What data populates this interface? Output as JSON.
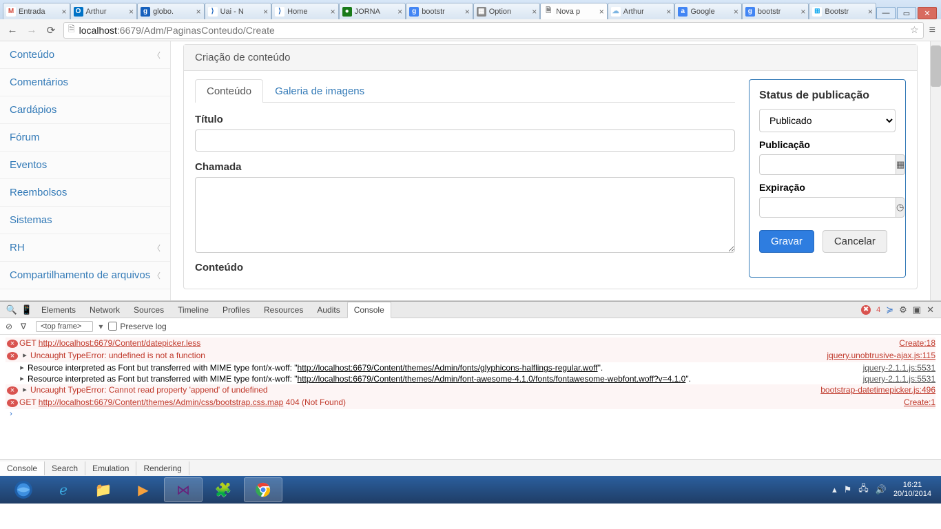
{
  "browser": {
    "tabs": [
      {
        "label": "Entrada",
        "favicon_bg": "#fff",
        "favicon_fg": "#d54b3d",
        "favicon_text": "M"
      },
      {
        "label": "Arthur",
        "favicon_bg": "#0072c6",
        "favicon_fg": "#fff",
        "favicon_text": "O"
      },
      {
        "label": "globo.",
        "favicon_bg": "#1560bd",
        "favicon_fg": "#fff",
        "favicon_text": "g"
      },
      {
        "label": "Uai - N",
        "favicon_bg": "#fff",
        "favicon_fg": "#1560bd",
        "favicon_text": "⟩"
      },
      {
        "label": "Home",
        "favicon_bg": "#fff",
        "favicon_fg": "#1560bd",
        "favicon_text": "⟩"
      },
      {
        "label": "JORNA",
        "favicon_bg": "#1a7a1a",
        "favicon_fg": "#fff",
        "favicon_text": "●"
      },
      {
        "label": "bootstr",
        "favicon_bg": "#4285f4",
        "favicon_fg": "#fff",
        "favicon_text": "g"
      },
      {
        "label": "Option",
        "favicon_bg": "#888",
        "favicon_fg": "#fff",
        "favicon_text": "▦"
      },
      {
        "label": "Nova p",
        "favicon_bg": "#fff",
        "favicon_fg": "#888",
        "favicon_text": "🗎",
        "active": true
      },
      {
        "label": "Arthur",
        "favicon_bg": "#fff",
        "favicon_fg": "#7cb5e2",
        "favicon_text": "☁"
      },
      {
        "label": "Google",
        "favicon_bg": "#4285f4",
        "favicon_fg": "#fff",
        "favicon_text": "a"
      },
      {
        "label": "bootstr",
        "favicon_bg": "#4285f4",
        "favicon_fg": "#fff",
        "favicon_text": "g"
      },
      {
        "label": "Bootstr",
        "favicon_bg": "#fff",
        "favicon_fg": "#00a4ef",
        "favicon_text": "⊞"
      }
    ],
    "url_host": "localhost",
    "url_port": ":6679",
    "url_path": "/Adm/PaginasConteudo/Create"
  },
  "sidebar": {
    "items": [
      {
        "label": "Conteúdo",
        "chevron": true
      },
      {
        "label": "Comentários"
      },
      {
        "label": "Cardápios"
      },
      {
        "label": "Fórum"
      },
      {
        "label": "Eventos"
      },
      {
        "label": "Reembolsos"
      },
      {
        "label": "Sistemas"
      },
      {
        "label": "RH",
        "chevron": true
      },
      {
        "label": "Compartilhamento de arquivos",
        "chevron": true
      }
    ]
  },
  "page": {
    "panel_title": "Criação de conteúdo",
    "tabs": {
      "content": "Conteúdo",
      "gallery": "Galeria de imagens"
    },
    "fields": {
      "title_label": "Título",
      "call_label": "Chamada",
      "content_label": "Conteúdo"
    },
    "publish": {
      "heading": "Status de publicação",
      "selected": "Publicado",
      "pub_label": "Publicação",
      "exp_label": "Expiração",
      "save": "Gravar",
      "cancel": "Cancelar"
    }
  },
  "devtools": {
    "tabs": {
      "elements": "Elements",
      "network": "Network",
      "sources": "Sources",
      "timeline": "Timeline",
      "profiles": "Profiles",
      "resources": "Resources",
      "audits": "Audits",
      "console": "Console"
    },
    "error_count": "4",
    "filter": {
      "frame": "<top frame>",
      "preserve": "Preserve log"
    },
    "logs": [
      {
        "type": "error",
        "method": "GET",
        "text_u": "http://localhost:6679/Content/datepicker.less",
        "src": "Create:18"
      },
      {
        "type": "uncaught",
        "text": "Uncaught TypeError: undefined is not a function",
        "src": "jquery.unobtrusive-ajax.js:115"
      },
      {
        "type": "info",
        "text_a": "Resource interpreted as Font but transferred with MIME type font/x-woff: \"",
        "text_u": "http://localhost:6679/Content/themes/Admin/fonts/glyphicons-halflings-regular.woff",
        "text_b": "\".",
        "src": "jquery-2.1.1.js:5531"
      },
      {
        "type": "info",
        "text_a": "Resource interpreted as Font but transferred with MIME type font/x-woff: \"",
        "text_u": "http://localhost:6679/Content/themes/Admin/font-awesome-4.1.0/fonts/fontawesome-webfont.woff?v=4.1.0",
        "text_b": "\".",
        "src": "jquery-2.1.1.js:5531"
      },
      {
        "type": "uncaught",
        "text": "Uncaught TypeError: Cannot read property 'append' of undefined",
        "src": "bootstrap-datetimepicker.js:496"
      },
      {
        "type": "error",
        "method": "GET",
        "text_u": "http://localhost:6679/Content/themes/Admin/css/bootstrap.css.map",
        "suffix": " 404 (Not Found)",
        "src": "Create:1"
      }
    ],
    "bottom_tabs": {
      "console": "Console",
      "search": "Search",
      "emulation": "Emulation",
      "rendering": "Rendering"
    }
  },
  "taskbar": {
    "time": "16:21",
    "date": "20/10/2014"
  }
}
